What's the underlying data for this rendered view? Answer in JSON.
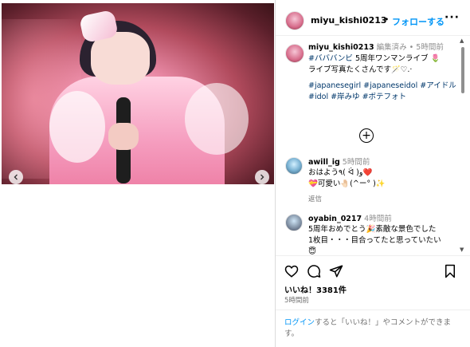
{
  "post": {
    "username": "miyu_kishi0213",
    "follow_label": "フォローする",
    "dot": "•",
    "more_label": "···"
  },
  "caption": {
    "username": "miyu_kishi0213",
    "edited": "編集済み",
    "bullet": "•",
    "time": "5時間前",
    "tag1": "#バババンビ",
    "text1": " 5周年ワンマンライブ 🌷",
    "text2": "ライブ写真たくさんです🪄♡.·",
    "hashtags": "#japanesegirl #japaneseidol #アイドル #idol #岸みゆ #ボテフォト"
  },
  "add_more_icon": "plus-circle-icon",
  "comments": [
    {
      "username": "awill_ig",
      "time": "5時間前",
      "text": "おはよう٩( ᐛ )و❤️\n💝可愛い🤚🏻(^ー° )✨",
      "reply": "返信"
    },
    {
      "username": "oyabin_0217",
      "time": "4時間前",
      "text": "5周年おめでとう🎉素敵な景色でした\n1枚目・・・目合ってたと思っていたい\n😇"
    }
  ],
  "likes": "いいね！3381件",
  "post_time": "5時間前",
  "login": {
    "link": "ログイン",
    "text": "すると「いいね！」やコメントができます。"
  },
  "colors": {
    "link_blue": "#0095f6",
    "hashtag": "#00376b",
    "muted": "#8e8e8e"
  }
}
